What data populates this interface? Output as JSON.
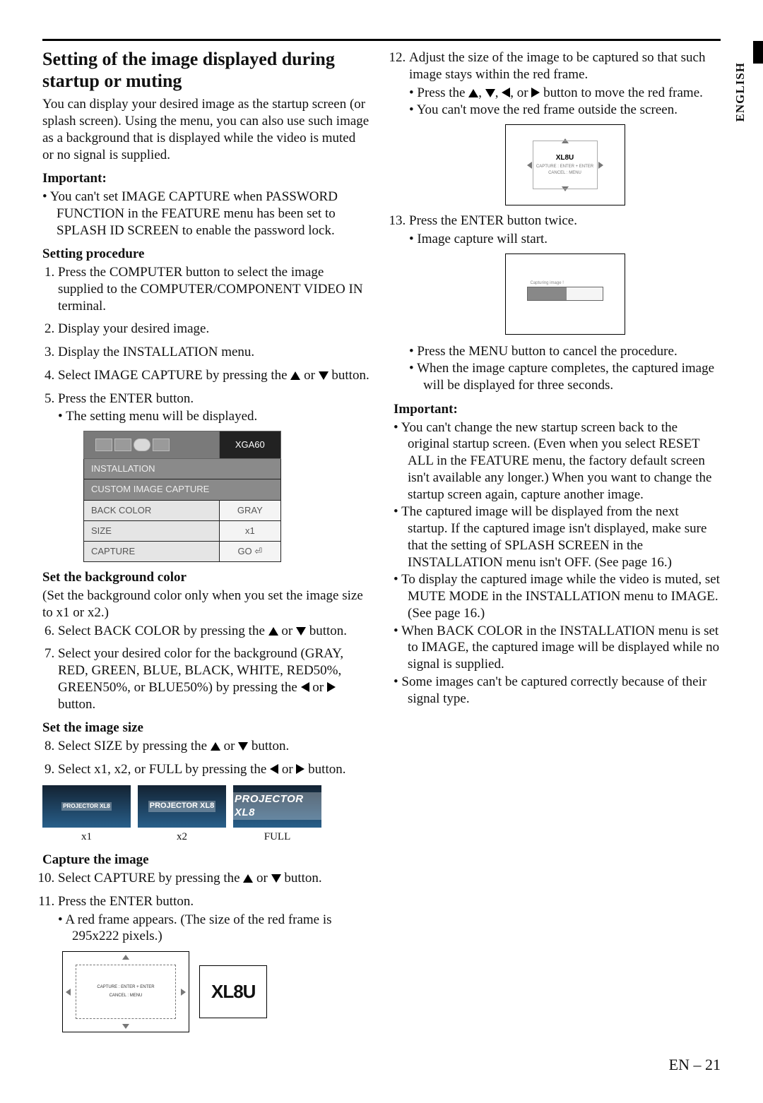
{
  "sideLabel": "ENGLISH",
  "left": {
    "title": "Setting of the image displayed during startup or muting",
    "intro": "You can display your desired image as the startup screen (or splash screen). Using the menu, you can also use such image as a background that is displayed while the video is muted or no signal is supplied.",
    "importantLabel": "Important:",
    "importantBullet": "You can't set IMAGE CAPTURE when PASSWORD FUNCTION in the FEATURE menu has been set to SPLASH ID SCREEN to enable the password lock.",
    "procLabel": "Setting procedure",
    "steps": {
      "s1": "Press the COMPUTER button to select the image supplied to the COMPUTER/COMPONENT VIDEO IN terminal.",
      "s2": "Display your desired image.",
      "s3": "Display the INSTALLATION menu.",
      "s4a": "Select IMAGE CAPTURE by pressing the ",
      "s4b": " or ",
      "s4c": " button.",
      "s5": "Press the ENTER button.",
      "s5sub": "The setting menu will be displayed.",
      "s6a": "Select BACK COLOR by pressing the ",
      "s6b": " or ",
      "s6c": " button.",
      "s7a": "Select your desired color for the background (GRAY, RED, GREEN, BLUE, BLACK, WHITE, RED50%, GREEN50%, or  BLUE50%) by pressing the ",
      "s7b": " or ",
      "s7c": " button.",
      "s8a": "Select SIZE by pressing the ",
      "s8b": " or ",
      "s8c": " button.",
      "s9a": "Select x1, x2, or FULL by pressing the ",
      "s9b": " or ",
      "s9c": " button.",
      "s10a": "Select CAPTURE by pressing the ",
      "s10b": " or ",
      "s10c": " button.",
      "s11": "Press the ENTER button.",
      "s11sub": "A red frame appears.  (The size of the red frame is 295x222 pixels.)"
    },
    "menu": {
      "headRight": "XGA60",
      "row1": "INSTALLATION",
      "row2": "CUSTOM IMAGE CAPTURE",
      "r3a": "BACK COLOR",
      "r3b": "GRAY",
      "r4a": "SIZE",
      "r4b": "x1",
      "r5a": "CAPTURE",
      "r5b": "GO ⏎"
    },
    "setbgLabel": "Set the background color",
    "setbgNote": "(Set the background color only when you set the image size to x1 or x2.)",
    "setSizeLabel": "Set the image size",
    "thumbCaps": {
      "a": "x1",
      "b": "x2",
      "c": "FULL"
    },
    "thumbTag": "PROJECTOR XL8",
    "captureLabel": "Capture the image",
    "frame": {
      "line1": "CAPTURE : ENTER + ENTER",
      "line2": "CANCEL : MENU"
    },
    "xl8u": "XL8U"
  },
  "right": {
    "s12": "Adjust the size of the image to be captured so that such image stays within the red frame.",
    "s12sub1a": "Press the ",
    "s12sub1b": ", ",
    "s12sub1c": ", ",
    "s12sub1d": ", or ",
    "s12sub1e": " button to move the red frame.",
    "s12sub2": "You can't move the red frame outside the screen.",
    "figbrand": "XL8U",
    "figLine1": "CAPTURE : ENTER + ENTER",
    "figLine2": "CANCEL : MENU",
    "s13": "Press the ENTER button twice.",
    "s13sub": "Image capture will start.",
    "barText": "Capturing image !",
    "postA": "Press the MENU button to cancel the procedure.",
    "postB": "When the image capture completes, the captured image will be displayed for three seconds.",
    "importantLabel": "Important:",
    "imp1": "You can't change the new startup screen back to the original startup screen.  (Even when you select RESET ALL in the FEATURE menu, the factory default screen isn't available any longer.)  When you want to change the startup screen again, capture another image.",
    "imp2": "The captured image will be displayed from the next startup.  If the captured image isn't displayed, make sure that the setting of SPLASH SCREEN in the INSTALLATION menu isn't OFF.  (See page 16.)",
    "imp3": "To display the captured image while the video is muted, set MUTE MODE in the INSTALLATION menu to IMAGE.  (See page 16.)",
    "imp4": "When BACK COLOR in the INSTALLATION menu is set to IMAGE, the captured image will be displayed while no signal is supplied.",
    "imp5": "Some images can't be captured correctly because of their signal type."
  },
  "pageNo": "EN – 21"
}
